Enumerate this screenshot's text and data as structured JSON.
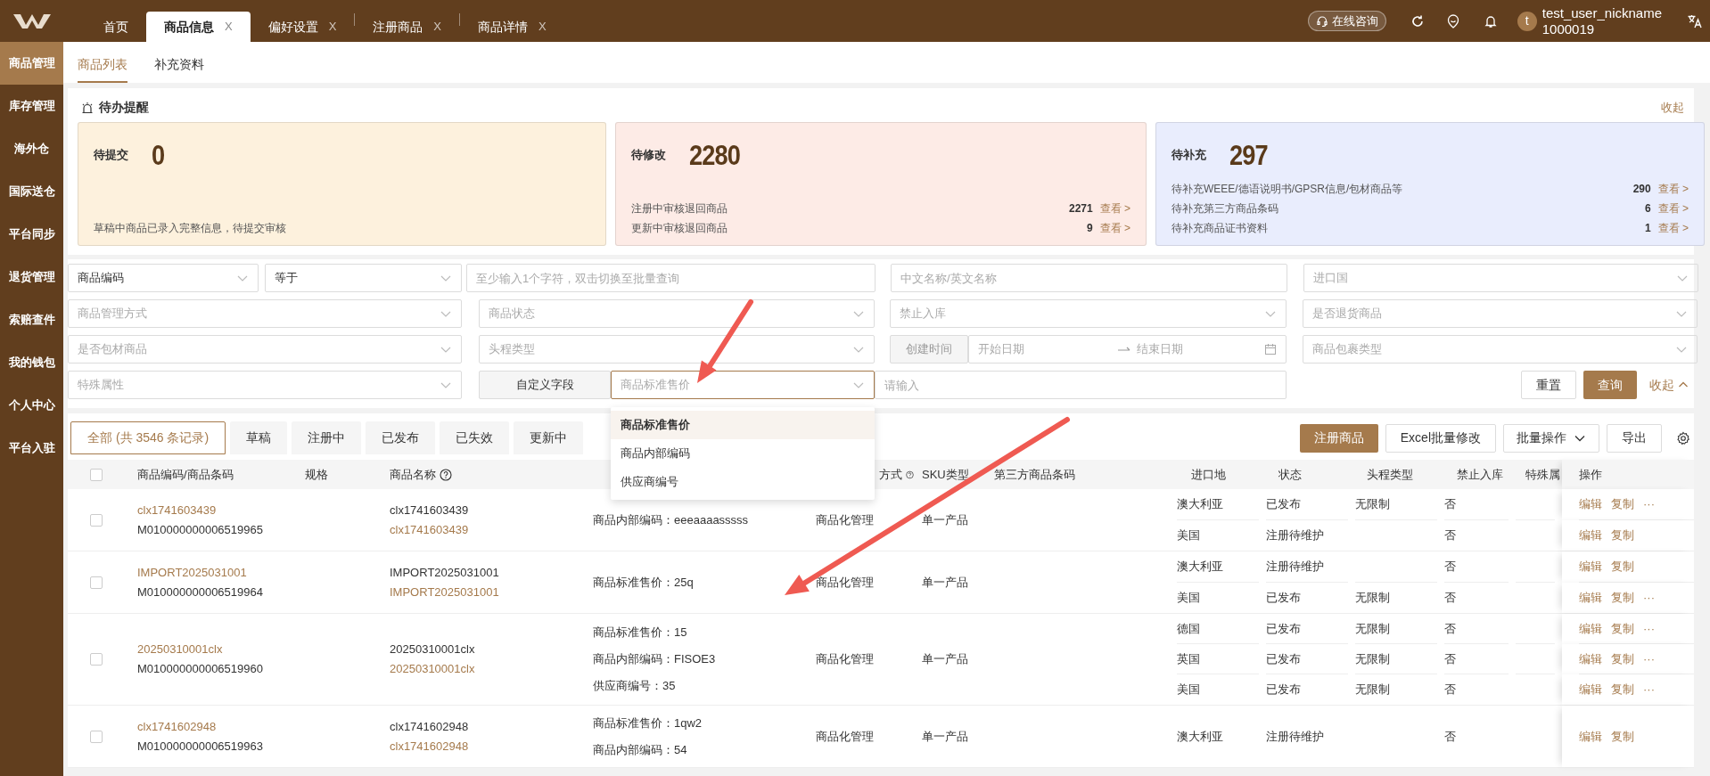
{
  "top_tabs": [
    {
      "label": "首页",
      "selected": false
    },
    {
      "label": "商品信息",
      "selected": true,
      "close": "X"
    },
    {
      "label": "偏好设置",
      "selected": false,
      "close": "X"
    },
    {
      "label": "注册商品",
      "selected": false,
      "close": "X"
    },
    {
      "label": "商品详情",
      "selected": false,
      "close": "X"
    }
  ],
  "consult_button": "在线咨询",
  "user": {
    "avatar": "t",
    "name": "test_user_nickname",
    "id": "1000019"
  },
  "sidebar": {
    "items": [
      {
        "label": "商品管理",
        "selected": true
      },
      {
        "label": "库存管理",
        "selected": false
      },
      {
        "label": "海外仓",
        "selected": false
      },
      {
        "label": "国际送仓",
        "selected": false
      },
      {
        "label": "平台同步",
        "selected": false
      },
      {
        "label": "退货管理",
        "selected": false
      },
      {
        "label": "索赔查件",
        "selected": false
      },
      {
        "label": "我的钱包",
        "selected": false
      },
      {
        "label": "个人中心",
        "selected": false
      },
      {
        "label": "平台入驻",
        "selected": false
      }
    ]
  },
  "sub_tabs": [
    {
      "label": "商品列表",
      "selected": true
    },
    {
      "label": "补充资料",
      "selected": false
    }
  ],
  "reminders": {
    "title": "待办提醒",
    "collapse": "收起",
    "cards": [
      {
        "title": "待提交",
        "count": "0",
        "color": "#fdf1dd",
        "lines": [
          {
            "text": "草稿中商品已录入完整信息，待提交审核"
          }
        ]
      },
      {
        "title": "待修改",
        "count": "2280",
        "color": "#fdebe6",
        "lines": [
          {
            "text": "注册中审核退回商品",
            "count": "2271",
            "link": "查看 >"
          },
          {
            "text": "更新中审核退回商品",
            "count": "9",
            "link": "查看 >"
          }
        ]
      },
      {
        "title": "待补充",
        "count": "297",
        "color": "#e9edfd",
        "lines": [
          {
            "text": "待补充WEEE/德语说明书/GPSR信息/包材商品等",
            "count": "290",
            "link": "查看 >"
          },
          {
            "text": "待补充第三方商品条码",
            "count": "6",
            "link": "查看 >"
          },
          {
            "text": "待补充商品证书资料",
            "count": "1",
            "link": "查看 >"
          }
        ]
      }
    ]
  },
  "filters": {
    "fields": [
      {
        "kind": "select",
        "value": "商品编码"
      },
      {
        "kind": "select",
        "value": "等于"
      },
      {
        "kind": "input",
        "placeholder": "至少输入1个字符，双击切换至批量查询"
      },
      {
        "kind": "input",
        "placeholder": "中文名称/英文名称"
      },
      {
        "kind": "select",
        "placeholder": "进口国"
      },
      {
        "kind": "select",
        "placeholder": "商品管理方式"
      },
      {
        "kind": "select",
        "placeholder": "商品状态"
      },
      {
        "kind": "select",
        "placeholder": "禁止入库"
      },
      {
        "kind": "select",
        "placeholder": "是否退货商品"
      },
      {
        "kind": "select",
        "placeholder": "是否包材商品"
      },
      {
        "kind": "select",
        "placeholder": "头程类型"
      },
      {
        "kind": "label",
        "label": "创建时间"
      },
      {
        "kind": "daterange",
        "start": "开始日期",
        "end": "结束日期"
      },
      {
        "kind": "select",
        "placeholder": "商品包裹类型"
      },
      {
        "kind": "select",
        "placeholder": "特殊属性"
      },
      {
        "kind": "label",
        "label": "自定义字段"
      },
      {
        "kind": "select",
        "placeholder": "商品标准售价",
        "open": true,
        "options": [
          {
            "label": "商品标准售价",
            "selected": true
          },
          {
            "label": "商品内部编码",
            "selected": false
          },
          {
            "label": "供应商编号",
            "selected": false
          }
        ]
      },
      {
        "kind": "input",
        "placeholder": "请输入"
      }
    ],
    "reset": "重置",
    "search": "查询",
    "collapse": "收起"
  },
  "status_tabs": [
    {
      "label": "全部 (共 3546 条记录)",
      "selected": true
    },
    {
      "label": "草稿",
      "selected": false
    },
    {
      "label": "注册中",
      "selected": false
    },
    {
      "label": "已发布",
      "selected": false
    },
    {
      "label": "已失效",
      "selected": false
    },
    {
      "label": "更新中",
      "selected": false
    }
  ],
  "toolbar": [
    {
      "label": "注册商品",
      "kind": "primary"
    },
    {
      "label": "Excel批量修改",
      "kind": "plain"
    },
    {
      "label": "批量操作",
      "kind": "menu"
    },
    {
      "label": "导出",
      "kind": "plain"
    }
  ],
  "table": {
    "header_checked": false,
    "columns": [
      {
        "label": "商品编码/商品条码",
        "kind": "plain"
      },
      {
        "label": "规格",
        "kind": "plain"
      },
      {
        "label": "商品名称",
        "kind": "help"
      },
      {
        "label": "方式",
        "kind": "help"
      },
      {
        "label": "SKU类型",
        "kind": "plain"
      },
      {
        "label": "第三方商品条码",
        "kind": "plain"
      },
      {
        "label": "进口地",
        "kind": "plain"
      },
      {
        "label": "状态",
        "kind": "plain"
      },
      {
        "label": "头程类型",
        "kind": "plain"
      },
      {
        "label": "禁止入库",
        "kind": "plain"
      },
      {
        "label": "特殊属",
        "kind": "plain"
      },
      {
        "label": "操作",
        "kind": "plain"
      }
    ],
    "rows": [
      {
        "checked": false,
        "code": "clx1741603439",
        "barcode": "M010000000006519965",
        "name": "clx1741603439",
        "name_code": "clx1741603439",
        "custom": [
          "商品内部编码：eeeaaaasssss"
        ],
        "management": "商品化管理",
        "sku_type": "单一产品",
        "variants": [
          {
            "country": "澳大利亚",
            "status": "已发布",
            "route": "无限制",
            "banned": "否",
            "actions": [
              "编辑",
              "复制",
              "···"
            ]
          },
          {
            "country": "美国",
            "status": "注册待维护",
            "banned": "否",
            "actions": [
              "编辑",
              "复制"
            ]
          }
        ]
      },
      {
        "checked": false,
        "code": "IMPORT2025031001",
        "barcode": "M010000000006519964",
        "name": "IMPORT2025031001",
        "name_code": "IMPORT2025031001",
        "custom": [
          "商品标准售价：25q"
        ],
        "management": "商品化管理",
        "sku_type": "单一产品",
        "variants": [
          {
            "country": "澳大利亚",
            "status": "注册待维护",
            "banned": "否",
            "actions": [
              "编辑",
              "复制"
            ]
          },
          {
            "country": "美国",
            "status": "已发布",
            "route": "无限制",
            "banned": "否",
            "actions": [
              "编辑",
              "复制",
              "···"
            ]
          }
        ]
      },
      {
        "checked": false,
        "code": "20250310001clx",
        "barcode": "M010000000006519960",
        "name": "20250310001clx",
        "name_code": "20250310001clx",
        "custom": [
          "商品标准售价：15",
          "商品内部编码：FISOE3",
          "供应商编号：35"
        ],
        "management": "商品化管理",
        "sku_type": "单一产品",
        "variants": [
          {
            "country": "德国",
            "status": "已发布",
            "route": "无限制",
            "banned": "否",
            "actions": [
              "编辑",
              "复制",
              "···"
            ]
          },
          {
            "country": "英国",
            "status": "已发布",
            "route": "无限制",
            "banned": "否",
            "actions": [
              "编辑",
              "复制",
              "···"
            ]
          },
          {
            "country": "美国",
            "status": "已发布",
            "route": "无限制",
            "banned": "否",
            "actions": [
              "编辑",
              "复制",
              "···"
            ]
          }
        ]
      },
      {
        "checked": false,
        "code": "clx1741602948",
        "barcode": "M010000000006519963",
        "name": "clx1741602948",
        "name_code": "clx1741602948",
        "custom": [
          "商品标准售价：1qw2",
          "商品内部编码：54"
        ],
        "management": "商品化管理",
        "sku_type": "单一产品",
        "variants": [
          {
            "country": "澳大利亚",
            "status": "注册待维护",
            "banned": "否",
            "actions": [
              "编辑",
              "复制"
            ]
          }
        ]
      }
    ]
  }
}
